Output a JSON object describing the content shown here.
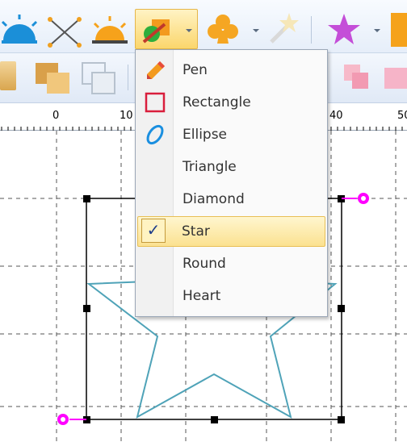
{
  "toolbar": {
    "row1_icons": [
      "half-sun-blue-icon",
      "cross-lines-icon",
      "half-sun-orange-icon",
      "shape-draw-icon",
      "club-icon",
      "magic-wand-icon",
      "star-icon",
      "orange-square-icon"
    ],
    "row2_icons": [
      "shape-a-icon",
      "bring-front-icon",
      "send-back-icon",
      "pink-shape-icon"
    ]
  },
  "ruler": {
    "ticks": [
      "0",
      "10",
      "40",
      "50"
    ]
  },
  "menu": {
    "items": [
      {
        "label": "Pen",
        "icon": "pencil-icon"
      },
      {
        "label": "Rectangle",
        "icon": "rectangle-icon"
      },
      {
        "label": "Ellipse",
        "icon": "ellipse-icon"
      },
      {
        "label": "Triangle",
        "icon": ""
      },
      {
        "label": "Diamond",
        "icon": ""
      },
      {
        "label": "Star",
        "icon": "check-icon",
        "selected": true
      },
      {
        "label": "Round",
        "icon": ""
      },
      {
        "label": "Heart",
        "icon": ""
      }
    ],
    "check_mark": "✓"
  },
  "colors": {
    "selection_handle": "#000000",
    "rotate_handle": "#ff00ff",
    "star_outline": "#4fa3b8",
    "selected_item_bg": "#fbe190"
  }
}
